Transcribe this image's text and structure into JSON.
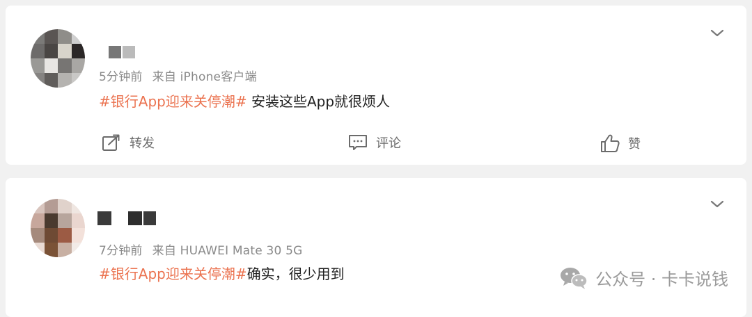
{
  "posts": [
    {
      "meta_time": "5分钟前",
      "meta_source": "来自 iPhone客户端",
      "topic": "#银行App迎来关停潮#",
      "text": " 安装这些App就很烦人",
      "actions": {
        "repost": "转发",
        "comment": "评论",
        "like": "赞"
      }
    },
    {
      "meta_time": "7分钟前",
      "meta_source": "来自 HUAWEI Mate 30 5G",
      "topic": "#银行App迎来关停潮#",
      "text": "确实，很少用到"
    }
  ],
  "watermark": {
    "text": "公众号 · 卡卡说钱"
  },
  "colors": {
    "topic": "#eb7350",
    "meta": "#8a8a8a",
    "background": "#f1f1f1"
  },
  "icons": [
    "repost-icon",
    "comment-icon",
    "like-icon",
    "chevron-down-icon",
    "wechat-icon"
  ]
}
